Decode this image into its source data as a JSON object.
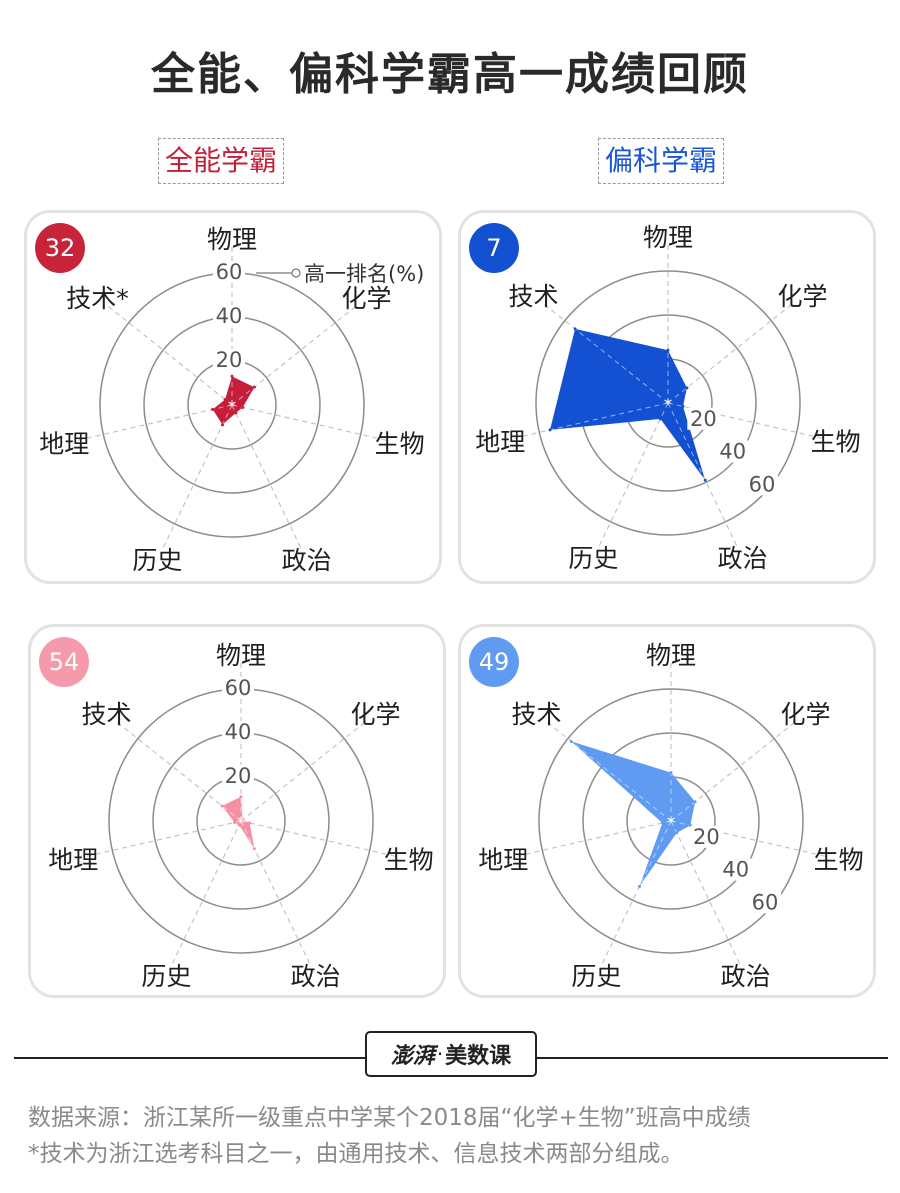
{
  "title": "全能、偏科学霸高一成绩回顾",
  "groups": [
    {
      "label": "全能学霸",
      "color": "#c41e3a"
    },
    {
      "label": "偏科学霸",
      "color": "#1a56d6"
    }
  ],
  "chart_data": [
    {
      "type": "radar",
      "id": "32",
      "badge_color": "#c7243a",
      "fill_color": "#c41e3a",
      "axes": [
        "物理",
        "化学",
        "生物",
        "政治",
        "历史",
        "地理",
        "技术*"
      ],
      "values": [
        13,
        13,
        5,
        4,
        10,
        9,
        4
      ],
      "ticks": [
        20,
        40,
        60
      ],
      "range": [
        0,
        60
      ],
      "annotation": "高一排名(%)"
    },
    {
      "type": "radar",
      "id": "7",
      "badge_color": "#1450d2",
      "fill_color": "#1450d2",
      "axes": [
        "物理",
        "化学",
        "生物",
        "政治",
        "历史",
        "地理",
        "技术"
      ],
      "values": [
        24,
        11,
        7,
        39,
        8,
        55,
        54
      ],
      "ticks": [
        20,
        40,
        60
      ],
      "range": [
        0,
        60
      ]
    },
    {
      "type": "radar",
      "id": "54",
      "badge_color": "#f59aaa",
      "fill_color": "#f590a4",
      "axes": [
        "物理",
        "化学",
        "生物",
        "政治",
        "历史",
        "地理",
        "技术"
      ],
      "values": [
        11,
        1,
        4,
        14,
        2,
        3,
        11
      ],
      "ticks": [
        20,
        40,
        60
      ],
      "range": [
        0,
        60
      ]
    },
    {
      "type": "radar",
      "id": "49",
      "badge_color": "#5f9bf0",
      "fill_color": "#5f9bf0",
      "axes": [
        "物理",
        "化学",
        "生物",
        "政治",
        "历史",
        "地理",
        "技术"
      ],
      "values": [
        22,
        14,
        9,
        6,
        33,
        4,
        58
      ],
      "ticks": [
        20,
        40,
        60
      ],
      "range": [
        0,
        60
      ]
    }
  ],
  "brand": {
    "logo": "澎湃",
    "separator": "·",
    "name": "美数课"
  },
  "source_lines": [
    "数据来源：浙江某所一级重点中学某个2018届“化学+生物”班高中成绩",
    "*技术为浙江选考科目之一，由通用技术、信息技术两部分组成。"
  ]
}
